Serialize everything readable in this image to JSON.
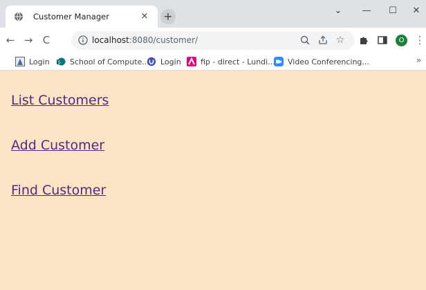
{
  "browser": {
    "tab": {
      "title": "Customer Manager",
      "close": "×"
    },
    "new_tab": "+",
    "window_controls": {
      "dropdown": "⌄",
      "minimize": "—",
      "maximize": "☐",
      "close": "✕"
    },
    "nav": {
      "back": "←",
      "forward": "→",
      "reload": "C"
    },
    "url": {
      "host": "localhost",
      "path": ":8080/customer/"
    },
    "omnibox_icons": {
      "zoom": "zoom-icon",
      "share": "share-icon",
      "bookmark": "☆"
    },
    "profile_initial": "O",
    "menu": "⋮",
    "bookmarks": [
      {
        "label": "Login",
        "icon": "login-favicon"
      },
      {
        "label": "School of Compute...",
        "icon": "school-favicon"
      },
      {
        "label": "Login",
        "icon": "at-login-favicon"
      },
      {
        "label": "fip - direct - Lundi...",
        "icon": "fip-favicon"
      },
      {
        "label": "Video Conferencing...",
        "icon": "video-favicon"
      }
    ],
    "bookmarks_more": "»"
  },
  "page": {
    "links": [
      {
        "label": "List Customers"
      },
      {
        "label": "Add Customer"
      },
      {
        "label": "Find Customer"
      }
    ]
  },
  "colors": {
    "page_background": "#fce3c3",
    "link": "#4e2a84",
    "tabstrip": "#dee1e6",
    "profile": "#188038"
  }
}
